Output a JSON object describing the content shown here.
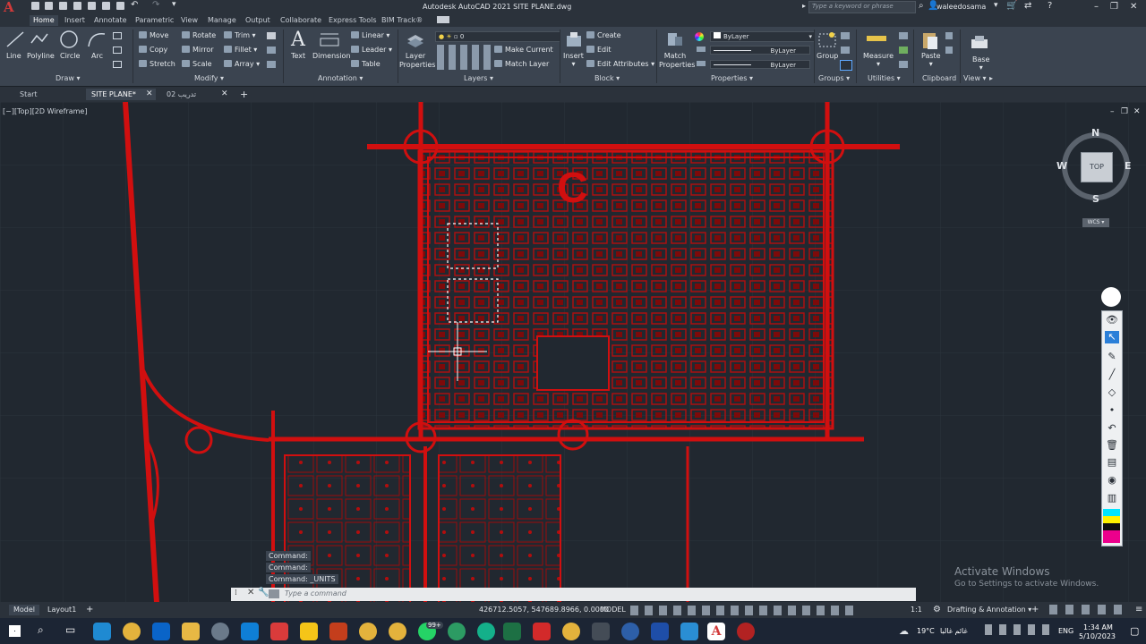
{
  "window": {
    "title": "Autodesk AutoCAD 2021   SITE PLANE.dwg",
    "search_placeholder": "Type a keyword or phrase",
    "user": "waleedosama"
  },
  "ribbon_tabs": [
    "Home",
    "Insert",
    "Annotate",
    "Parametric",
    "View",
    "Manage",
    "Output",
    "Collaborate",
    "Express Tools",
    "BIM Track®"
  ],
  "ribbon": {
    "draw": {
      "title": "Draw",
      "line": "Line",
      "polyline": "Polyline",
      "circle": "Circle",
      "arc": "Arc"
    },
    "modify": {
      "title": "Modify",
      "move": "Move",
      "rotate": "Rotate",
      "trim": "Trim",
      "copy": "Copy",
      "mirror": "Mirror",
      "fillet": "Fillet",
      "stretch": "Stretch",
      "scale": "Scale",
      "array": "Array"
    },
    "annotation": {
      "title": "Annotation",
      "text": "Text",
      "dimension": "Dimension",
      "linear": "Linear",
      "leader": "Leader",
      "table": "Table"
    },
    "layers": {
      "title": "Layers",
      "layer_properties": "Layer Properties",
      "current_layer": "0",
      "make_current": "Make Current",
      "match_layer": "Match Layer"
    },
    "block": {
      "title": "Block",
      "insert": "Insert",
      "create": "Create",
      "edit": "Edit",
      "edit_attributes": "Edit Attributes"
    },
    "properties": {
      "title": "Properties",
      "match_properties": "Match Properties",
      "color": "ByLayer",
      "linetype": "ByLayer",
      "lineweight": "ByLayer"
    },
    "groups": {
      "title": "Groups",
      "group": "Group"
    },
    "utilities": {
      "title": "Utilities",
      "measure": "Measure"
    },
    "clipboard": {
      "title": "Clipboard",
      "paste": "Paste"
    },
    "view": {
      "title": "View",
      "base": "Base"
    }
  },
  "file_tabs": [
    "Start",
    "SITE PLANE*",
    "تدريب 02"
  ],
  "viewport_label": "[−][Top][2D Wireframe]",
  "viewcube": {
    "top": "TOP",
    "n": "N",
    "s": "S",
    "e": "E",
    "w": "W",
    "wcs": "WCS"
  },
  "command_history": [
    "Command:",
    "Command:",
    "Command: _UNITS"
  ],
  "command_placeholder": "Type a command",
  "activate": {
    "title": "Activate Windows",
    "subtitle": "Go to Settings to activate Windows."
  },
  "status": {
    "tabs": [
      "Model",
      "Layout1"
    ],
    "coords": "426712.5057, 547689.8966, 0.0000",
    "model": "MODEL",
    "scale": "1:1",
    "workspace": "Drafting & Annotation"
  },
  "taskbar": {
    "weather": "19°C",
    "weather_text": "غائم غالبا",
    "lang": "ENG",
    "time": "1:34 AM",
    "date": "5/10/2023",
    "badge": "99+"
  },
  "colors": {
    "drawing": "#d10f0f",
    "background": "#212830",
    "ribbon": "#3b4450"
  }
}
